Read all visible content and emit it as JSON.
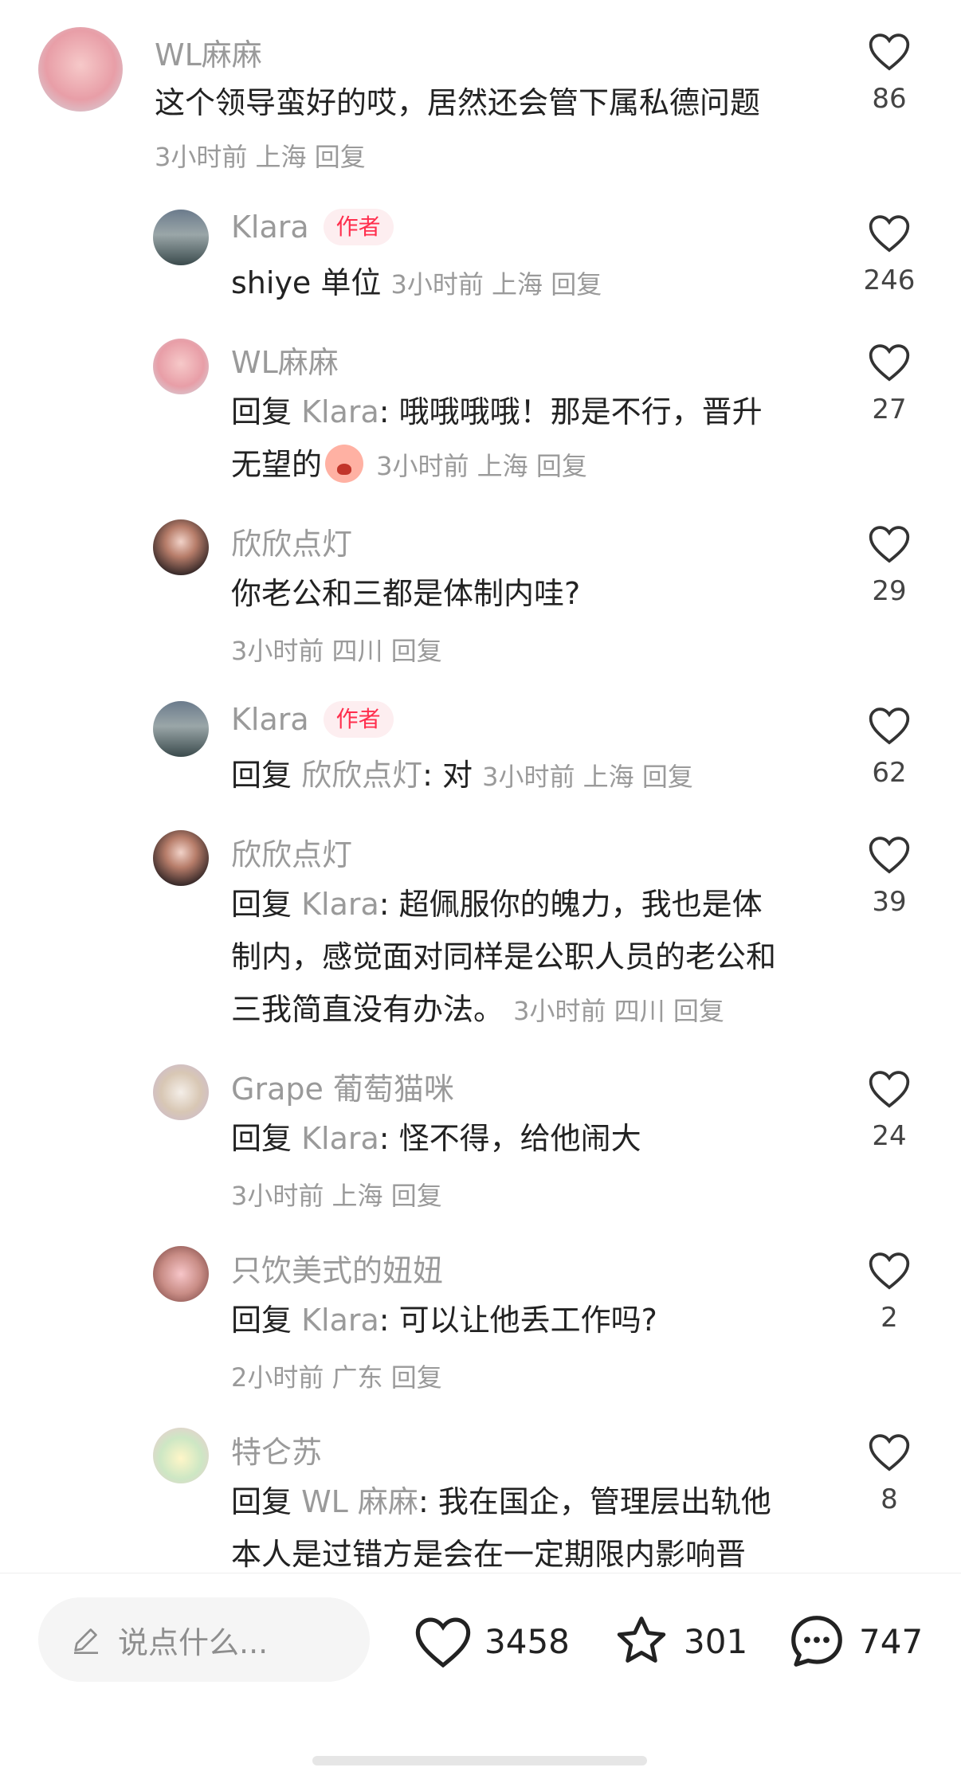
{
  "colors": {
    "accent": "#ff2e4d",
    "muted": "#9a9a9a",
    "text": "#222222"
  },
  "comments": [
    {
      "name": "WL麻麻",
      "text": "这个领导蛮好的哎，居然还会管下属私德问题",
      "meta": "3小时前 上海 回复",
      "likes": "86"
    },
    {
      "name": "Klara",
      "tag": "作者",
      "text": "shiye 单位",
      "meta": "3小时前 上海 回复",
      "likes": "246"
    },
    {
      "name": "WL麻麻",
      "reply_label": "回复",
      "reply_target": "Klara",
      "text1": ": 哦哦哦哦！那是不行，晋升",
      "text2": "无望的",
      "emoji": "crying-face",
      "meta": "3小时前 上海 回复",
      "likes": "27"
    },
    {
      "name": "欣欣点灯",
      "text": "你老公和三都是体制内哇?",
      "meta": "3小时前 四川 回复",
      "likes": "29"
    },
    {
      "name": "Klara",
      "tag": "作者",
      "reply_label": "回复",
      "reply_target": "欣欣点灯",
      "text": ": 对",
      "meta": "3小时前 上海 回复",
      "likes": "62"
    },
    {
      "name": "欣欣点灯",
      "reply_label": "回复",
      "reply_target": "Klara",
      "text1": ": 超佩服你的魄力，我也是体",
      "text2": "制内，感觉面对同样是公职人员的老公和",
      "text3": "三我简直没有办法。",
      "meta": "3小时前 四川 回复",
      "likes": "39"
    },
    {
      "name": "Grape 葡萄猫咪",
      "reply_label": "回复",
      "reply_target": "Klara",
      "text": ": 怪不得，给他闹大",
      "meta": "3小时前 上海 回复",
      "likes": "24"
    },
    {
      "name": "只饮美式的妞妞",
      "reply_label": "回复",
      "reply_target": "Klara",
      "text": ": 可以让他丢工作吗?",
      "meta": "2小时前 广东 回复",
      "likes": "2"
    },
    {
      "name": "特仑苏",
      "reply_label": "回复",
      "reply_target": "WL 麻麻",
      "text1": ": 我在国企，管理层出轨他",
      "text2": "本人是过错方是会在一定期限内影响晋",
      "likes": "8"
    }
  ],
  "bottom_bar": {
    "input_placeholder": "说点什么...",
    "likes": "3458",
    "favorites": "301",
    "comments": "747"
  }
}
